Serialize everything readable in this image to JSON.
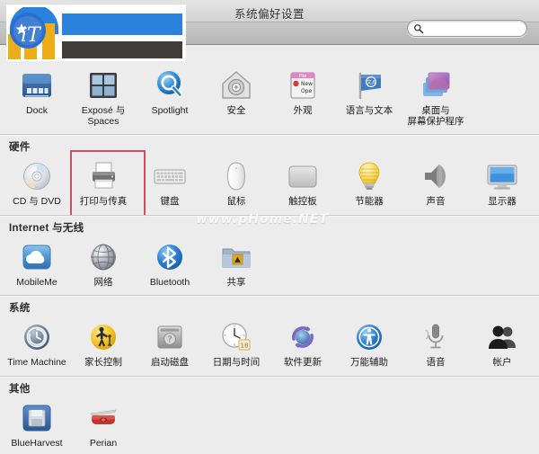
{
  "window": {
    "title": "系统偏好设置"
  },
  "search": {
    "value": "",
    "placeholder": "",
    "icon": "search-icon"
  },
  "watermark": {
    "text": "www.pHome.NET"
  },
  "sections": [
    {
      "id": "personal",
      "title": "",
      "show_title": false,
      "items": [
        {
          "label": "Dock",
          "icon": "dock-icon",
          "highlight": false
        },
        {
          "label": "Exposé 与\nSpaces",
          "icon": "expose-spaces-icon",
          "highlight": false
        },
        {
          "label": "Spotlight",
          "icon": "spotlight-icon",
          "highlight": false
        },
        {
          "label": "安全",
          "icon": "security-icon",
          "highlight": false
        },
        {
          "label": "外观",
          "icon": "appearance-icon",
          "highlight": false
        },
        {
          "label": "语言与文本",
          "icon": "language-text-icon",
          "highlight": false
        },
        {
          "label": "桌面与\n屏幕保护程序",
          "icon": "desktop-screensaver-icon",
          "highlight": false
        }
      ]
    },
    {
      "id": "hardware",
      "title": "硬件",
      "show_title": true,
      "items": [
        {
          "label": "CD 与 DVD",
          "icon": "cd-dvd-icon",
          "highlight": false
        },
        {
          "label": "打印与传真",
          "icon": "print-fax-icon",
          "highlight": true
        },
        {
          "label": "键盘",
          "icon": "keyboard-icon",
          "highlight": false
        },
        {
          "label": "鼠标",
          "icon": "mouse-icon",
          "highlight": false
        },
        {
          "label": "触控板",
          "icon": "trackpad-icon",
          "highlight": false
        },
        {
          "label": "节能器",
          "icon": "energy-saver-icon",
          "highlight": false
        },
        {
          "label": "声音",
          "icon": "sound-icon",
          "highlight": false
        },
        {
          "label": "显示器",
          "icon": "displays-icon",
          "highlight": false
        }
      ]
    },
    {
      "id": "internet",
      "title": "Internet 与无线",
      "show_title": true,
      "items": [
        {
          "label": "MobileMe",
          "icon": "mobileme-icon",
          "highlight": false
        },
        {
          "label": "网络",
          "icon": "network-icon",
          "highlight": false
        },
        {
          "label": "Bluetooth",
          "icon": "bluetooth-icon",
          "highlight": false
        },
        {
          "label": "共享",
          "icon": "sharing-icon",
          "highlight": false
        }
      ]
    },
    {
      "id": "system",
      "title": "系统",
      "show_title": true,
      "items": [
        {
          "label": "Time Machine",
          "icon": "time-machine-icon",
          "highlight": false
        },
        {
          "label": "家长控制",
          "icon": "parental-controls-icon",
          "highlight": false
        },
        {
          "label": "启动磁盘",
          "icon": "startup-disk-icon",
          "highlight": false
        },
        {
          "label": "日期与时间",
          "icon": "date-time-icon",
          "highlight": false
        },
        {
          "label": "软件更新",
          "icon": "software-update-icon",
          "highlight": false
        },
        {
          "label": "万能辅助",
          "icon": "universal-access-icon",
          "highlight": false
        },
        {
          "label": "语音",
          "icon": "speech-icon",
          "highlight": false
        },
        {
          "label": "帐户",
          "icon": "accounts-icon",
          "highlight": false
        }
      ]
    },
    {
      "id": "other",
      "title": "其他",
      "show_title": true,
      "items": [
        {
          "label": "BlueHarvest",
          "icon": "blueharvest-icon",
          "highlight": false
        },
        {
          "label": "Perian",
          "icon": "perian-icon",
          "highlight": false
        }
      ]
    }
  ]
}
